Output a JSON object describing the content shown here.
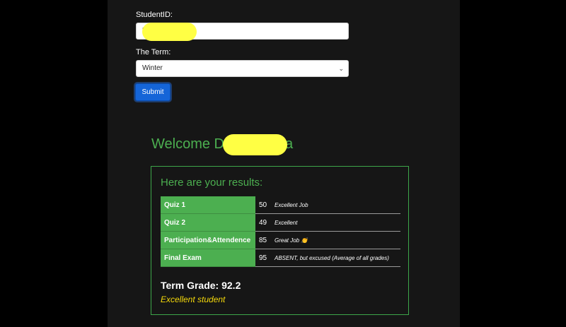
{
  "form": {
    "student_id_label": "StudentID:",
    "student_id_value": "5",
    "term_label": "The Term:",
    "term_selected": "Winter",
    "submit_label": "Submit"
  },
  "results": {
    "welcome_prefix": "Welcome D",
    "welcome_suffix": "a",
    "heading": "Here are your results:",
    "rows": [
      {
        "name": "Quiz 1",
        "score": "50",
        "comment": "Excellent Job"
      },
      {
        "name": "Quiz 2",
        "score": "49",
        "comment": "Excellent"
      },
      {
        "name": "Participation&Attendence",
        "score": "85",
        "comment": "Great Job 👏"
      },
      {
        "name": "Final Exam",
        "score": "95",
        "comment": "ABSENT, but excused (Average of all grades)"
      }
    ],
    "term_grade_label": "Term Grade:",
    "term_grade_value": "92.2",
    "verdict": "Excellent student"
  },
  "colors": {
    "accent_green": "#4caf50",
    "submit_blue": "#1565d8",
    "verdict_yellow": "#f5d90a"
  }
}
